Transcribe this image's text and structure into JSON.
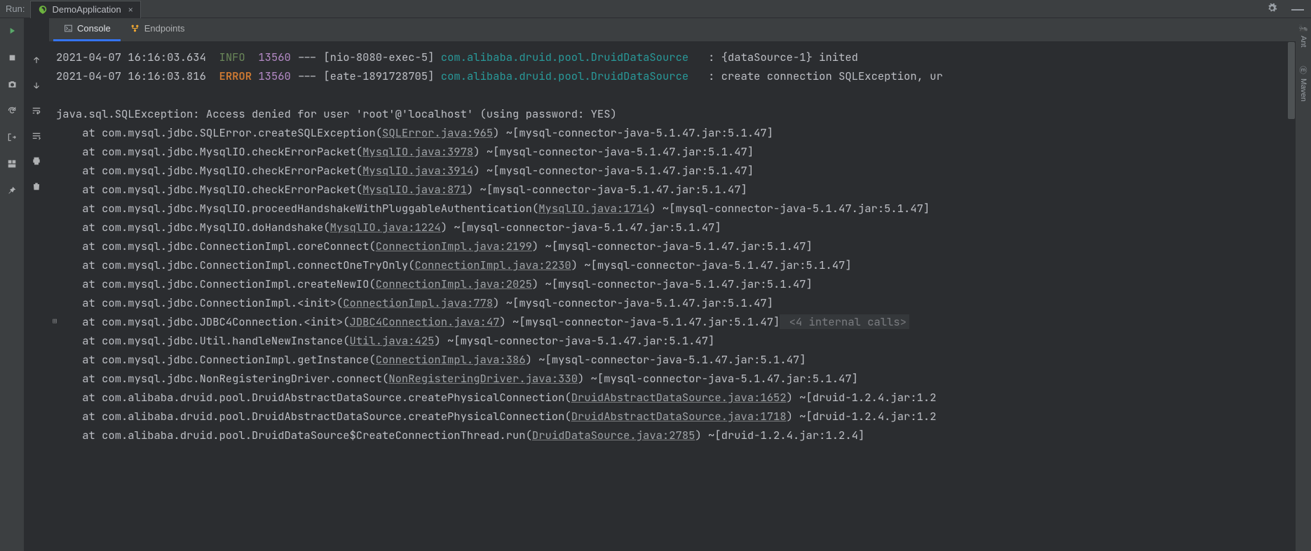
{
  "run_label": "Run:",
  "run_config": "DemoApplication",
  "panel_tabs": {
    "console": "Console",
    "endpoints": "Endpoints"
  },
  "right_tabs": {
    "ant": "Ant",
    "maven": "Maven"
  },
  "log_entries": [
    {
      "ts": "2021-04-07 16:16:03.634",
      "level": "INFO",
      "level_cls": "info",
      "pid": "13560",
      "thread": "[nio-8080-exec-5]",
      "class": "com.alibaba.druid.pool.DruidDataSource",
      "msg": "{dataSource-1} inited"
    },
    {
      "ts": "2021-04-07 16:16:03.816",
      "level": "ERROR",
      "level_cls": "error",
      "pid": "13560",
      "thread": "[eate-1891728705]",
      "class": "com.alibaba.druid.pool.DruidDataSource",
      "msg": "create connection SQLException, ur"
    }
  ],
  "exception_header": "java.sql.SQLException: Access denied for user 'root'@'localhost' (using password: YES)",
  "stack": [
    {
      "at": "at com.mysql.jdbc.SQLError.createSQLException(",
      "link": "SQLError.java:965",
      "tail": ") ~[mysql-connector-java-5.1.47.jar:5.1.47]"
    },
    {
      "at": "at com.mysql.jdbc.MysqlIO.checkErrorPacket(",
      "link": "MysqlIO.java:3978",
      "tail": ") ~[mysql-connector-java-5.1.47.jar:5.1.47]"
    },
    {
      "at": "at com.mysql.jdbc.MysqlIO.checkErrorPacket(",
      "link": "MysqlIO.java:3914",
      "tail": ") ~[mysql-connector-java-5.1.47.jar:5.1.47]"
    },
    {
      "at": "at com.mysql.jdbc.MysqlIO.checkErrorPacket(",
      "link": "MysqlIO.java:871",
      "tail": ") ~[mysql-connector-java-5.1.47.jar:5.1.47]"
    },
    {
      "at": "at com.mysql.jdbc.MysqlIO.proceedHandshakeWithPluggableAuthentication(",
      "link": "MysqlIO.java:1714",
      "tail": ") ~[mysql-connector-java-5.1.47.jar:5.1.47]"
    },
    {
      "at": "at com.mysql.jdbc.MysqlIO.doHandshake(",
      "link": "MysqlIO.java:1224",
      "tail": ") ~[mysql-connector-java-5.1.47.jar:5.1.47]"
    },
    {
      "at": "at com.mysql.jdbc.ConnectionImpl.coreConnect(",
      "link": "ConnectionImpl.java:2199",
      "tail": ") ~[mysql-connector-java-5.1.47.jar:5.1.47]"
    },
    {
      "at": "at com.mysql.jdbc.ConnectionImpl.connectOneTryOnly(",
      "link": "ConnectionImpl.java:2230",
      "tail": ") ~[mysql-connector-java-5.1.47.jar:5.1.47]"
    },
    {
      "at": "at com.mysql.jdbc.ConnectionImpl.createNewIO(",
      "link": "ConnectionImpl.java:2025",
      "tail": ") ~[mysql-connector-java-5.1.47.jar:5.1.47]"
    },
    {
      "at": "at com.mysql.jdbc.ConnectionImpl.<init>(",
      "link": "ConnectionImpl.java:778",
      "tail": ") ~[mysql-connector-java-5.1.47.jar:5.1.47]"
    },
    {
      "at": "at com.mysql.jdbc.JDBC4Connection.<init>(",
      "link": "JDBC4Connection.java:47",
      "tail": ") ~[mysql-connector-java-5.1.47.jar:5.1.47]",
      "extra": " <4 internal calls>",
      "marker": true
    },
    {
      "at": "at com.mysql.jdbc.Util.handleNewInstance(",
      "link": "Util.java:425",
      "tail": ") ~[mysql-connector-java-5.1.47.jar:5.1.47]"
    },
    {
      "at": "at com.mysql.jdbc.ConnectionImpl.getInstance(",
      "link": "ConnectionImpl.java:386",
      "tail": ") ~[mysql-connector-java-5.1.47.jar:5.1.47]"
    },
    {
      "at": "at com.mysql.jdbc.NonRegisteringDriver.connect(",
      "link": "NonRegisteringDriver.java:330",
      "tail": ") ~[mysql-connector-java-5.1.47.jar:5.1.47]"
    },
    {
      "at": "at com.alibaba.druid.pool.DruidAbstractDataSource.createPhysicalConnection(",
      "link": "DruidAbstractDataSource.java:1652",
      "tail": ") ~[druid-1.2.4.jar:1.2"
    },
    {
      "at": "at com.alibaba.druid.pool.DruidAbstractDataSource.createPhysicalConnection(",
      "link": "DruidAbstractDataSource.java:1718",
      "tail": ") ~[druid-1.2.4.jar:1.2"
    },
    {
      "at": "at com.alibaba.druid.pool.DruidDataSource$CreateConnectionThread.run(",
      "link": "DruidDataSource.java:2785",
      "tail": ") ~[druid-1.2.4.jar:1.2.4]"
    }
  ]
}
